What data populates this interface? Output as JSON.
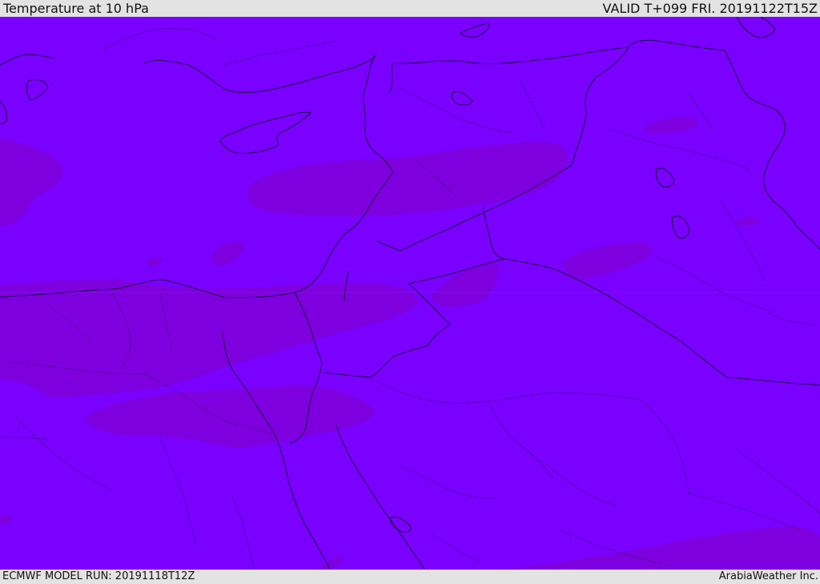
{
  "header": {
    "title": "Temperature at 10 hPa",
    "valid_time": "VALID T+099 FRI. 20191122T15Z"
  },
  "footer": {
    "model_run": "ECMWF MODEL RUN: 20191118T12Z",
    "credit": "ArabiaWeather Inc."
  },
  "map": {
    "fill_color": "#7a00ff",
    "contour_color": "#7e00de",
    "border_color": "#1a0040"
  }
}
